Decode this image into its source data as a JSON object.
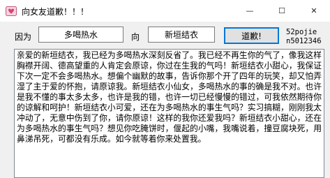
{
  "window": {
    "title": "向女友道歉！！！",
    "controls": {
      "minimize": "—",
      "maximize": "☐",
      "close": "✕"
    }
  },
  "form": {
    "because_label": "因为",
    "reason_value": "多喝热水",
    "to_label": "向",
    "name_value": "新垣结衣",
    "apologize_button": "道歉!",
    "credit_line1": "52pojie",
    "credit_line2": "n5012346"
  },
  "memo": {
    "text": "亲爱的新垣结衣，我已经为多喝热水深刻反省了。我已经不再生你的气了，像我这样胸襟开阔、德高望重的人肯定会原谅，你过在生我的气吗！新垣结衣小甜心，我保证下次一定不会多喝热水。想偏个幽默的故事，告诉你那个开了四年的玩笑，却又怕弄湿了主于爱的怀抱，请原谅我。新垣结衣小仙女，多喝热水的事的确是我不对。也许是我不懂的事太多太多，也许是我的错，也许一切已经慢慢的错过，可我依然期待你的谅解和呵护！新垣结衣小可爱，还在为多喝热水的事生气吗？实习搞糊，刚刚我太冲动了，无意中伤到了你，请你原谅！这样的我你还爱我吗？新垣结衣小甜心，还在为多喝热水的事生气吗？想见你吃腌饼时，偃起的小嘴，我嘴说着，撞豆腐块死，用鼻涕吊死，可都没有乐成。如今就等着你来处置我。"
  }
}
